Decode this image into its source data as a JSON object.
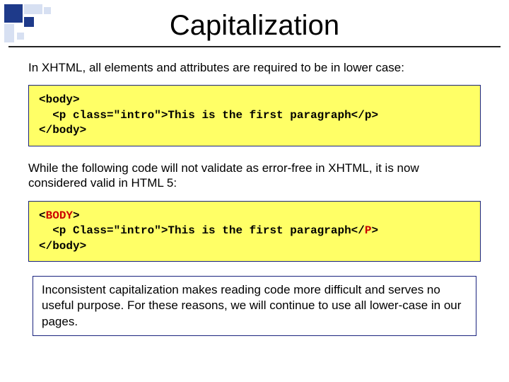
{
  "title": "Capitalization",
  "para1": "In XHTML, all elements and attributes are required to be in lower case:",
  "code1": {
    "l1": "<body>",
    "l2_indent": "  <p class=\"intro\">This is the first paragraph</p>",
    "l3": "</body>"
  },
  "para2": "While the following code will not validate as error-free in XHTML, it is now considered valid in HTML 5:",
  "code2": {
    "l1_open": "<",
    "l1_body": "BODY",
    "l1_close": ">",
    "l2_a": "  <p Class=\"intro\">This is the first paragraph</",
    "l2_P": "P",
    "l2_b": ">",
    "l3": "</body>"
  },
  "note": "Inconsistent capitalization makes reading code more difficult and serves no useful purpose.  For these reasons, we will continue to use all lower-case in our pages."
}
